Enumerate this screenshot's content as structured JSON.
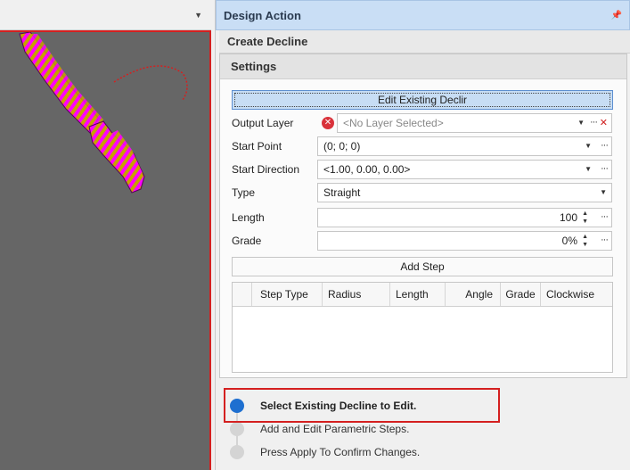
{
  "panel": {
    "title": "Design Action",
    "pin_icon": "pin-icon"
  },
  "section": {
    "title": "Create Decline"
  },
  "settings": {
    "title": "Settings",
    "edit_button": "Edit Existing Declir",
    "rows": {
      "output_layer": {
        "label": "Output Layer",
        "value": "<No Layer Selected>"
      },
      "start_point": {
        "label": "Start Point",
        "value": "(0; 0; 0)"
      },
      "start_direction": {
        "label": "Start Direction",
        "value": "<1.00, 0.00, 0.00>"
      },
      "type": {
        "label": "Type",
        "value": "Straight"
      },
      "length": {
        "label": "Length",
        "value": "100"
      },
      "grade": {
        "label": "Grade",
        "value": "0%"
      }
    },
    "add_step": "Add Step",
    "columns": [
      "Step Type",
      "Radius",
      "Length",
      "Angle",
      "Grade",
      "Clockwise"
    ]
  },
  "steps": [
    {
      "text": "Select Existing Decline to Edit.",
      "active": true
    },
    {
      "text": "Add and Edit Parametric Steps.",
      "active": false
    },
    {
      "text": "Press Apply To Confirm Changes.",
      "active": false
    }
  ],
  "colors": {
    "accent": "#1e6fd0",
    "highlight": "#d42020",
    "header_bg": "#c9def5",
    "viewport_bg": "#666666",
    "model_magenta": "#ff00ff",
    "model_gold": "#c8a000"
  }
}
